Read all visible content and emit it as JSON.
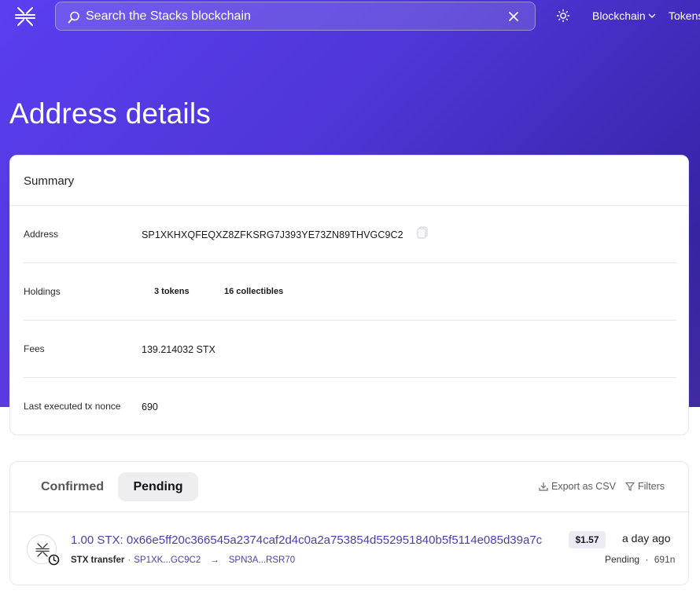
{
  "nav": {
    "search_placeholder": "Search the Stacks blockchain",
    "blockchain_label": "Blockchain",
    "tokens_label": "Tokens"
  },
  "page": {
    "title": "Address details"
  },
  "summary": {
    "title": "Summary",
    "address_label": "Address",
    "address_value": "SP1XKHXQFEQXZ8ZFKSRG7J393YE73ZN89THVGC9C2",
    "holdings_label": "Holdings",
    "tokens_count": "3 tokens",
    "collectibles_count": "16 collectibles",
    "fees_label": "Fees",
    "fees_value": "139.214032 STX",
    "nonce_label": "Last executed tx nonce",
    "nonce_value": "690"
  },
  "transactions": {
    "tabs": [
      "Confirmed",
      "Pending"
    ],
    "active_tab": "Pending",
    "export_label": "Export as CSV",
    "filters_label": "Filters",
    "items": [
      {
        "title": "1.00 STX: 0x66e5ff20c366545a2374caf2d4c0a2a753854d552951840b5f5114e085d39a7c",
        "type": "STX transfer",
        "from": "SP1XK...GC9C2",
        "arrow": "→",
        "to": "SPN3A...RSR70",
        "price": "$1.57",
        "time": "a day ago",
        "status": "Pending",
        "nonce": "691n"
      }
    ]
  },
  "colors": {
    "hero_start": "#5a3ef0",
    "hero_end": "#2f2188",
    "link": "#4a3fb0"
  }
}
